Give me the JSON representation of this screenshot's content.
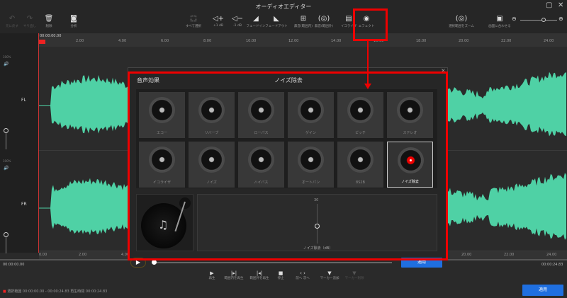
{
  "window": {
    "title": "オーディオエディター",
    "maximize_icon": "maximize-icon",
    "close_icon": "close-icon"
  },
  "toolbar": {
    "items": [
      {
        "label": "元に戻す",
        "icon": "undo-icon",
        "enabled": false
      },
      {
        "label": "やり直し",
        "icon": "redo-icon",
        "enabled": false
      },
      {
        "label": "削除",
        "icon": "trash-icon",
        "enabled": true
      },
      {
        "label": "分析",
        "icon": "analyze-icon",
        "enabled": true
      },
      {
        "label": "すべて選択",
        "icon": "select-all-icon",
        "enabled": true
      },
      {
        "label": "+1 dB",
        "icon": "volume-up-icon",
        "enabled": true
      },
      {
        "label": "-1 dB",
        "icon": "volume-down-icon",
        "enabled": true
      },
      {
        "label": "フェードイン",
        "icon": "fade-in-icon",
        "enabled": true
      },
      {
        "label": "フェードアウト",
        "icon": "fade-out-icon",
        "enabled": true
      },
      {
        "label": "無音(範囲内)",
        "icon": "silence-inside-icon",
        "enabled": true
      },
      {
        "label": "無音(範囲外)",
        "icon": "silence-outside-icon",
        "enabled": true
      },
      {
        "label": "イコライザ",
        "icon": "equalizer-icon",
        "enabled": true
      },
      {
        "label": "エフェクト",
        "icon": "effect-icon",
        "enabled": true
      },
      {
        "label": "選択範囲をズーム",
        "icon": "zoom-selection-icon",
        "enabled": true
      },
      {
        "label": "画面に合わせる",
        "icon": "fit-screen-icon",
        "enabled": true
      }
    ],
    "zoom_level": 0.75
  },
  "ruler": {
    "start": "00:00:00.00",
    "ticks": [
      "2.00",
      "4.00",
      "6.00",
      "8.00",
      "10.00",
      "12.00",
      "14.00",
      "16.00",
      "18.00",
      "20.00",
      "22.00",
      "24.00"
    ]
  },
  "bottom_ruler": {
    "ticks": [
      "0.00",
      "2.00",
      "4.00",
      "20.00",
      "22.00",
      "24.00"
    ]
  },
  "tracks": [
    {
      "channel": "FL",
      "volume": "100%"
    },
    {
      "channel": "FR",
      "volume": "100%"
    }
  ],
  "waveform_color": "#4fd1a5",
  "time": {
    "start": "00:00:00.00",
    "end": "00:00:24.83"
  },
  "playback": [
    {
      "label": "再生",
      "icon": "play-icon",
      "enabled": true
    },
    {
      "label": "範囲内を再生",
      "icon": "play-inside-icon",
      "enabled": true
    },
    {
      "label": "範囲外を再生",
      "icon": "play-outside-icon",
      "enabled": true
    },
    {
      "label": "停止",
      "icon": "stop-icon",
      "enabled": true
    },
    {
      "label": "前へ 次へ",
      "icon": "prev-next-icon",
      "enabled": true
    },
    {
      "label": "マーカー追加",
      "icon": "marker-add-icon",
      "enabled": true
    },
    {
      "label": "マーカー削除",
      "icon": "marker-delete-icon",
      "enabled": false
    }
  ],
  "status": "選択範囲 00:00:00.00 - 00:00:24.83 再生時間 00:00:24.83",
  "apply_label": "適用",
  "dialog": {
    "heading": "音声効果",
    "selected_title": "ノイズ除去",
    "effects": [
      "エコー",
      "リバーブ",
      "ローパス",
      "ゲイン",
      "ピッチ",
      "ステレオ",
      "イコライザ",
      "ノイズ",
      "ハイパス",
      "オートパン",
      "8S2B",
      "ノイズ除去"
    ],
    "selected_index": 11,
    "slider": {
      "max_label": "30",
      "label": "ノイズ除去（dB）",
      "value_fraction": 0.45
    },
    "apply_label": "適用",
    "progress": 0
  },
  "highlight_color": "#e00000"
}
